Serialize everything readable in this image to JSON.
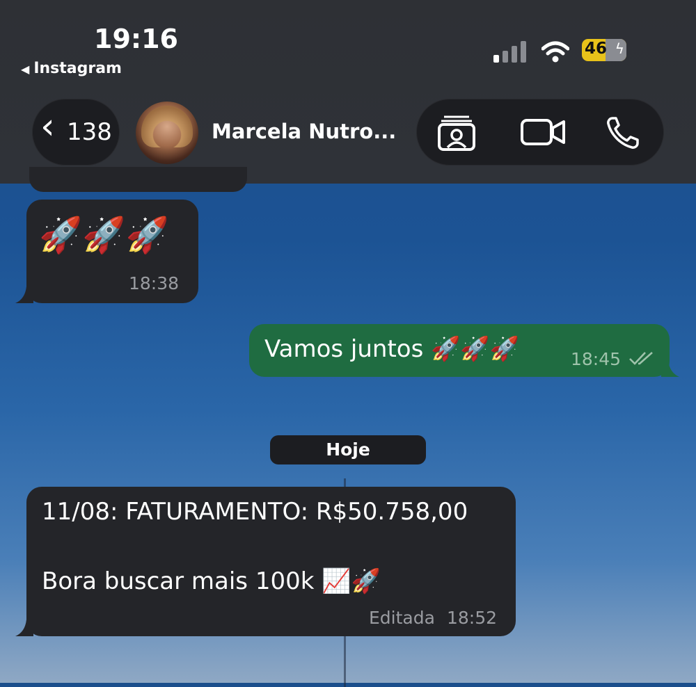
{
  "status_bar": {
    "time": "19:16",
    "back_app": "Instagram",
    "battery": "46",
    "battery_color": "#e8c21a",
    "icons": [
      "cellular-signal-icon",
      "wifi-icon",
      "battery-charging-icon"
    ]
  },
  "nav": {
    "back_count": "138",
    "contact_name": "Marcela Nutro...",
    "actions": [
      "contact-card-icon",
      "video-call-icon",
      "phone-icon"
    ]
  },
  "messages": [
    {
      "direction": "in",
      "text": "🚀🚀🚀",
      "time": "18:38"
    },
    {
      "direction": "out",
      "text": "Vamos juntos 🚀🚀🚀",
      "time": "18:45",
      "status": "read-double-check"
    }
  ],
  "day_separator": "Hoje",
  "last_message": {
    "direction": "in",
    "line1": "11/08: FATURAMENTO: R$50.758,00",
    "line2": "Bora buscar mais 100k 📈🚀",
    "edited": "Editada",
    "time": "18:52"
  },
  "colors": {
    "incoming_bubble": "#242529",
    "outgoing_bubble": "#1f6c41",
    "background": "#1c5394"
  }
}
